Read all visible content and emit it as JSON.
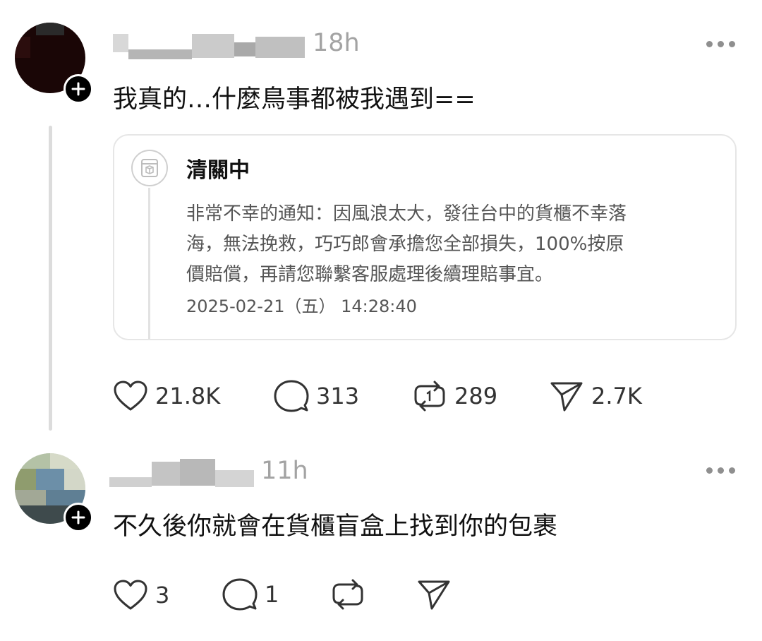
{
  "posts": [
    {
      "time": "18h",
      "text": "我真的…什麼鳥事都被我遇到==",
      "quote": {
        "title": "清關中",
        "body_lines": [
          "非常不幸的通知：因風浪太大，發往台中的貨櫃不幸落",
          "海，無法挽救，巧巧郎會承擔您全部損失，100%按原",
          "價賠償，再請您聯繫客服處理後續理賠事宜。"
        ],
        "date": "2025-02-21（五） 14:28:40"
      },
      "actions": {
        "likes": "21.8K",
        "comments": "313",
        "reposts": "289",
        "shares": "2.7K"
      }
    },
    {
      "time": "11h",
      "text": "不久後你就會在貨櫃盲盒上找到你的包裹",
      "actions": {
        "likes": "3",
        "comments": "1",
        "reposts": "",
        "shares": ""
      }
    }
  ],
  "colors": {
    "text": "#111111",
    "muted": "#a3a3a3",
    "border": "#e6e6e6",
    "icon": "#333333"
  }
}
